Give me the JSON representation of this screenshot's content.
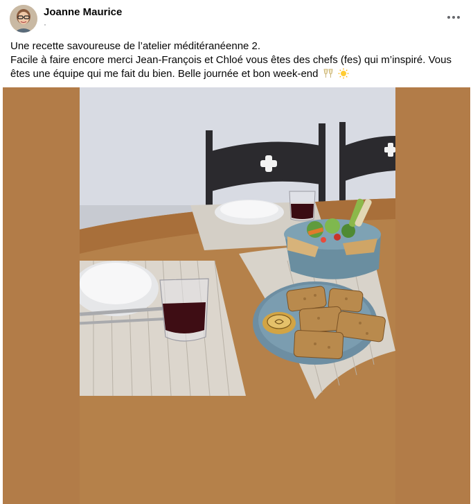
{
  "post": {
    "author_name": "Joanne Maurice",
    "meta": "·",
    "text_line_1": "Une recette savoureuse de l’atelier méditéranéenne 2.",
    "text_line_2": "Facile à faire encore merci Jean-François et Chloé vous êtes des chefs (fes) qui m’inspiré.  Vous êtes une équipe qui me fait du bien.  Belle journée et bon week-end",
    "emojis": [
      "clinking-glasses-icon",
      "sun-icon"
    ]
  },
  "media": {
    "description_icon": "photo-table-setting",
    "background_color": "#b27c48"
  }
}
